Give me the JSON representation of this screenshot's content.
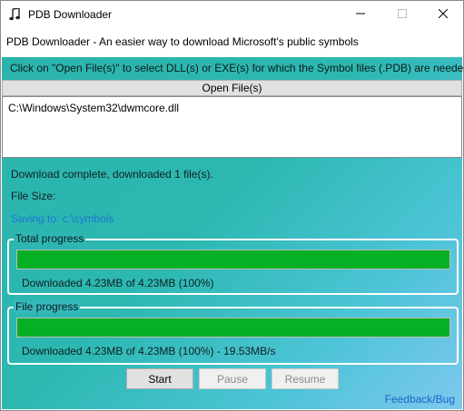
{
  "window": {
    "title": "PDB Downloader",
    "icon": "music-note-icon",
    "controls": [
      "minimize-icon",
      "maximize-icon",
      "close-icon"
    ]
  },
  "subtitle": "PDB Downloader - An easier way to download Microsoft's public symbols",
  "instructions": "Click on \"Open File(s)\" to select DLL(s) or EXE(s) for which the Symbol files (.PDB) are needed",
  "open_files_label": "Open File(s)",
  "files": [
    "C:\\Windows\\System32\\dwmcore.dll"
  ],
  "status": {
    "download": "Download complete, downloaded 1 file(s).",
    "file_size": "File Size:",
    "saving_to": "Saving to: c:\\symbols"
  },
  "total_progress": {
    "label": "Total progress",
    "percent": 100,
    "text": "Downloaded 4.23MB of 4.23MB (100%)"
  },
  "file_progress": {
    "label": "File progress",
    "percent": 100,
    "text": "Downloaded 4.23MB of 4.23MB (100%) - 19.53MB/s"
  },
  "buttons": {
    "start": "Start",
    "pause": "Pause",
    "resume": "Resume"
  },
  "feedback_label": "Feedback/Bug",
  "colors": {
    "accent_teal": "#2cb3ad",
    "progress_green": "#06b025",
    "link_blue": "#1b78d4"
  }
}
